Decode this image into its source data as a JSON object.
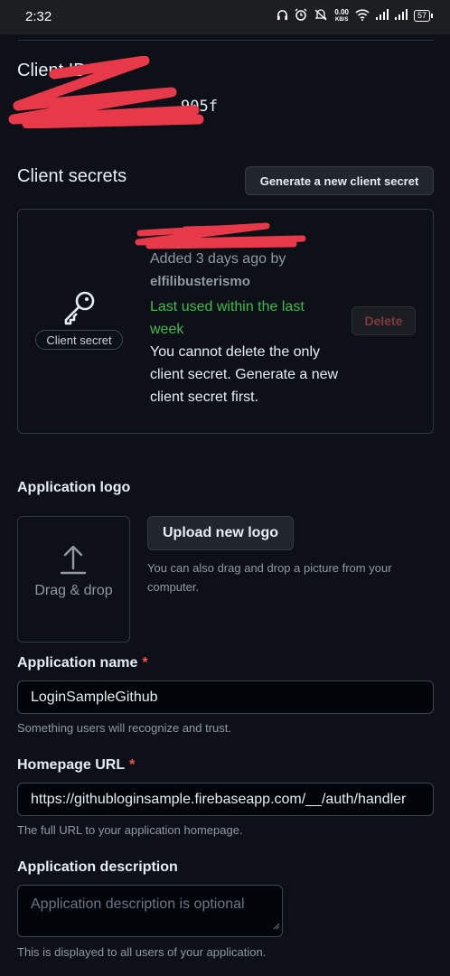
{
  "status_bar": {
    "time": "2:32",
    "speed_value": "0.00",
    "speed_unit": "KB/S",
    "battery": "57"
  },
  "client_id": {
    "heading": "Client ID",
    "value_visible": "905f"
  },
  "client_secrets": {
    "heading": "Client secrets",
    "generate_button": "Generate a new client secret",
    "secret": {
      "label": "Client secret",
      "added_text": "Added 3 days ago by",
      "added_by": "elfilibusterismo",
      "last_used": "Last used within the last week",
      "warning": "You cannot delete the only client secret. Generate a new client secret first.",
      "delete_button": "Delete",
      "icon": "key-icon"
    }
  },
  "application_logo": {
    "label": "Application logo",
    "drop_text": "Drag & drop",
    "upload_button": "Upload new logo",
    "help_text": "You can also drag and drop a picture from your computer."
  },
  "application_name": {
    "label": "Application name",
    "required_marker": "*",
    "value": "LoginSampleGithub",
    "help_text": "Something users will recognize and trust."
  },
  "homepage_url": {
    "label": "Homepage URL",
    "required_marker": "*",
    "value": "https://githubloginsample.firebaseapp.com/__/auth/handler",
    "help_text": "The full URL to your application homepage."
  },
  "application_description": {
    "label": "Application description",
    "placeholder": "Application description is optional",
    "help_text": "This is displayed to all users of your application."
  },
  "colors": {
    "background": "#0d1117",
    "border": "#30363d",
    "success_text": "#3fb950",
    "danger": "#f85149",
    "redaction": "#e8394a"
  }
}
